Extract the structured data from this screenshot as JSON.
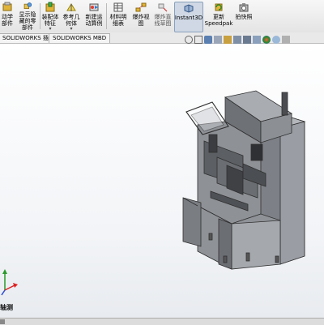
{
  "ribbon": {
    "buttons": [
      {
        "label": "动学\n部件",
        "icon": "component-icon"
      },
      {
        "label": "显示隐\n藏的零\n部件",
        "icon": "show-hidden-parts-icon"
      },
      {
        "label": "装配体\n特征",
        "icon": "assembly-feature-icon"
      },
      {
        "label": "参考几\n何体",
        "icon": "reference-geometry-icon"
      },
      {
        "label": "新建运\n动算例",
        "icon": "motion-study-icon"
      },
      {
        "label": "材料明\n细表",
        "icon": "bom-icon"
      },
      {
        "label": "爆炸视\n图",
        "icon": "exploded-view-icon"
      },
      {
        "label": "爆炸直\n线草图",
        "icon": "explode-line-sketch-icon"
      },
      {
        "label": "Instant3D",
        "icon": "instant3d-icon"
      },
      {
        "label": "更新\nSpeedpak",
        "icon": "speedpak-icon"
      },
      {
        "label": "拍快照",
        "icon": "snapshot-icon"
      }
    ]
  },
  "tabs": [
    "SOLIDWORKS 插件",
    "SOLIDWORKS MBD"
  ],
  "view_label": "轴测"
}
